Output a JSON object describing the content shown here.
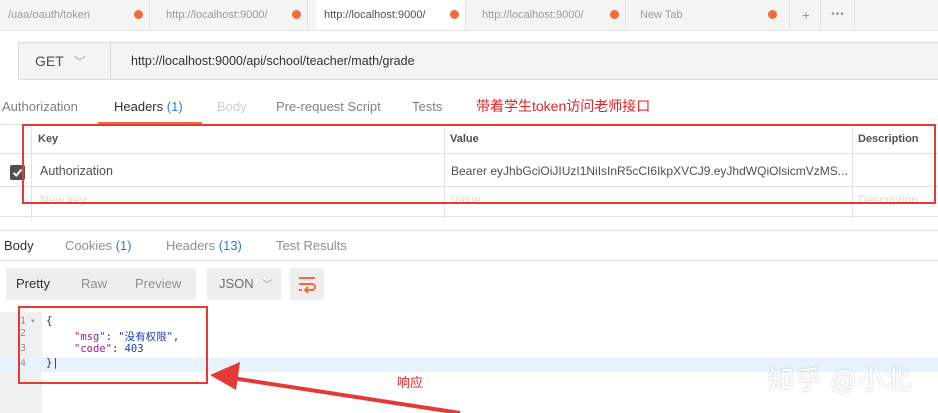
{
  "tabs": [
    {
      "label": "/uaa/oauth/token"
    },
    {
      "label": "http://localhost:9000/"
    },
    {
      "label": "http://localhost:9000/"
    },
    {
      "label": "http://localhost:9000/"
    },
    {
      "label": "New Tab"
    }
  ],
  "tab_controls": {
    "add": "+",
    "more": "•••"
  },
  "request": {
    "method": "GET",
    "url": "http://localhost:9000/api/school/teacher/math/grade"
  },
  "request_tabs": {
    "authorization": "Authorization",
    "headers": "Headers",
    "headers_count": "(1)",
    "body": "Body",
    "prerequest": "Pre-request Script",
    "tests": "Tests"
  },
  "annotation_top": "带着学生token访问老师接口",
  "headers_table": {
    "columns": {
      "key": "Key",
      "value": "Value",
      "description": "Description"
    },
    "rows": [
      {
        "key": "Authorization",
        "value": "Bearer eyJhbGciOiJIUzI1NiIsInR5cCI6IkpXVCJ9.eyJhdWQiOlsicmVzMS..."
      }
    ],
    "new_row": {
      "key": "New key",
      "value": "Value",
      "description": "Description"
    }
  },
  "response_tabs": {
    "body": "Body",
    "cookies": "Cookies",
    "cookies_count": "(1)",
    "headers": "Headers",
    "headers_count": "(13)",
    "test_results": "Test Results"
  },
  "response_controls": {
    "pretty": "Pretty",
    "raw": "Raw",
    "preview": "Preview",
    "format": "JSON"
  },
  "response_body": {
    "line_numbers": [
      "1",
      "2",
      "3",
      "4"
    ],
    "open_brace": "{",
    "msg_key": "\"msg\"",
    "msg_value": "\"没有权限\"",
    "code_key": "\"code\"",
    "code_value": "403",
    "close_brace": "}"
  },
  "annotation_bottom": "响应",
  "watermark": "知乎 @小北",
  "colors": {
    "accent": "#f26b3a",
    "annotation": "#e53935",
    "count": "#2b7cd3"
  }
}
